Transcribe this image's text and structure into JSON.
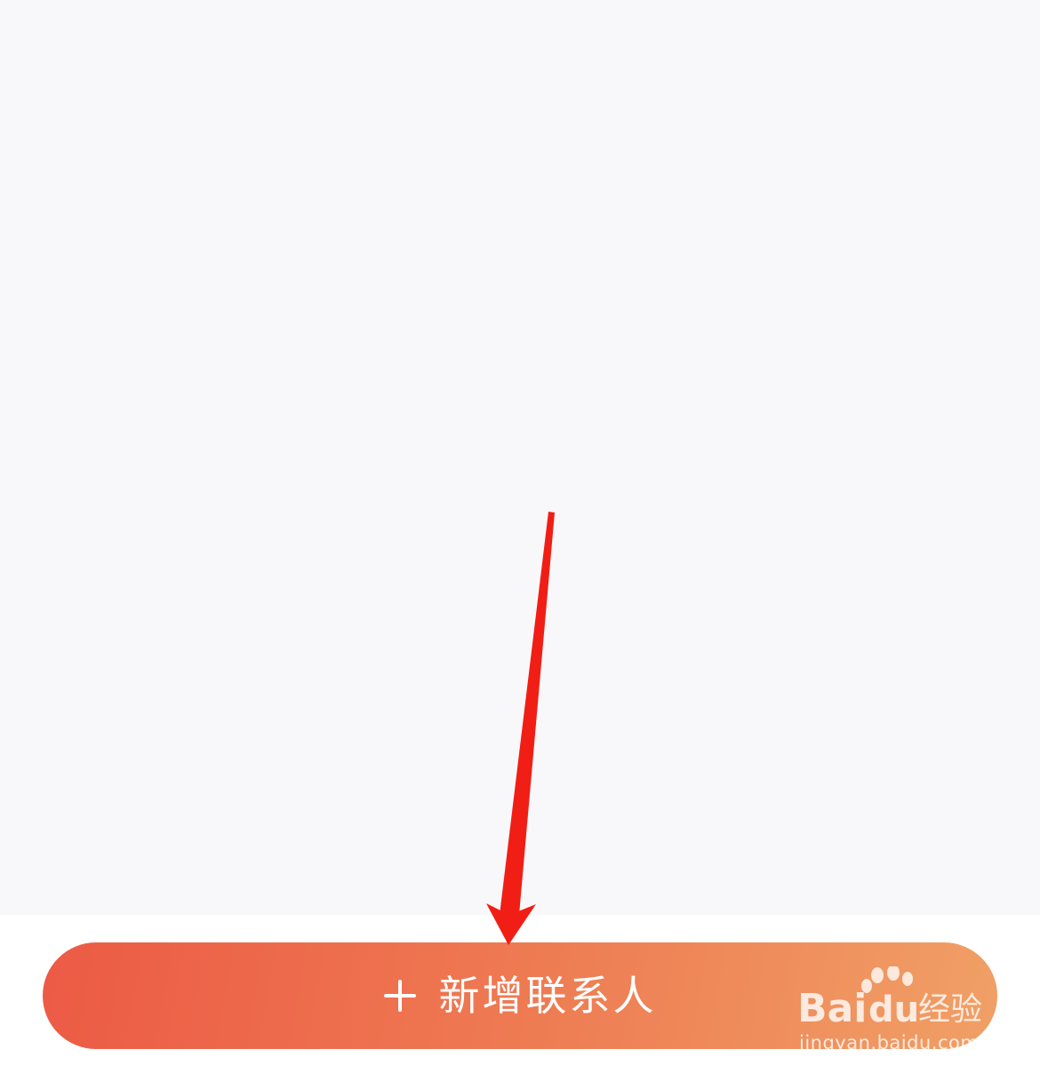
{
  "bottom_bar": {
    "add_button": {
      "label": "新增联系人",
      "icon": "plus-icon"
    }
  },
  "watermark": {
    "logo_text": "Baidu经验",
    "url": "jingyan.baidu.com"
  },
  "colors": {
    "content_background": "#f8f8fa",
    "button_gradient_start": "#ec5a45",
    "button_gradient_end": "#f0a066",
    "annotation_arrow": "#f11e16"
  }
}
